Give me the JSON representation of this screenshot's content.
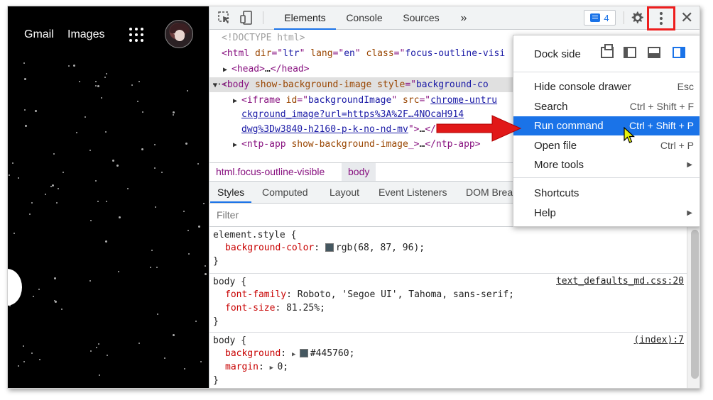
{
  "ntp": {
    "links": [
      "Gmail",
      "Images"
    ]
  },
  "devtools": {
    "tabs": [
      "Elements",
      "Console",
      "Sources"
    ],
    "more_tabs": "»",
    "badge_count": "4",
    "close": "✕",
    "dom_lines": [
      {
        "indent": 0,
        "parts": [
          [
            "gray",
            "<!DOCTYPE html>"
          ]
        ]
      },
      {
        "indent": 0,
        "parts": [
          [
            "tag",
            "<html "
          ],
          [
            "attr",
            "dir"
          ],
          [
            "tag",
            "=\""
          ],
          [
            "val",
            "ltr"
          ],
          [
            "tag",
            "\" "
          ],
          [
            "attr",
            "lang"
          ],
          [
            "tag",
            "=\""
          ],
          [
            "val",
            "en"
          ],
          [
            "tag",
            "\" "
          ],
          [
            "attr",
            "class"
          ],
          [
            "tag",
            "=\""
          ],
          [
            "val",
            "focus-outline-visi"
          ]
        ]
      },
      {
        "indent": 1,
        "tri": "▶",
        "parts": [
          [
            "tag",
            "<head>"
          ],
          [
            "plain",
            "…"
          ],
          [
            "tag",
            "</head>"
          ]
        ]
      },
      {
        "indent": 0,
        "tri": "▼",
        "prefix": "···",
        "sel": true,
        "parts": [
          [
            "tag",
            "<body "
          ],
          [
            "attr",
            "show-background-image"
          ],
          [
            "tag",
            " "
          ],
          [
            "attr",
            "style"
          ],
          [
            "tag",
            "=\""
          ],
          [
            "val",
            "background-co"
          ]
        ]
      },
      {
        "indent": 2,
        "tri": "▶",
        "parts": [
          [
            "tag",
            "<iframe "
          ],
          [
            "attr",
            "id"
          ],
          [
            "tag",
            "=\""
          ],
          [
            "val",
            "backgroundImage"
          ],
          [
            "tag",
            "\" "
          ],
          [
            "attr",
            "src"
          ],
          [
            "tag",
            "=\""
          ],
          [
            "link",
            "chrome-untru"
          ]
        ]
      },
      {
        "indent": 2,
        "parts": [
          [
            "link",
            "ckground_image?url=https%3A%2F…4NOcaH914"
          ]
        ]
      },
      {
        "indent": 2,
        "parts": [
          [
            "link",
            "dwg%3Dw3840-h2160-p-k-no-nd-mv"
          ],
          [
            "tag",
            "\">"
          ],
          [
            "plain",
            "…"
          ],
          [
            "tag",
            "</iframe"
          ]
        ]
      },
      {
        "indent": 2,
        "tri": "▶",
        "parts": [
          [
            "tag",
            "<ntp-app "
          ],
          [
            "attr",
            "show-background-image"
          ],
          [
            "tag",
            "_>"
          ],
          [
            "plain",
            "…"
          ],
          [
            "tag",
            "</ntp-app>"
          ]
        ]
      }
    ],
    "breadcrumbs": [
      "html.focus-outline-visible",
      "body"
    ],
    "subtabs": [
      "Styles",
      "Computed",
      "Layout",
      "Event Listeners",
      "DOM Brea"
    ],
    "filter_placeholder": "Filter",
    "rules": [
      {
        "selector": "element.style {",
        "source": "",
        "props": [
          {
            "name": "background-color",
            "value": "rgb(68, 87, 96);",
            "swatch": "#445760"
          }
        ]
      },
      {
        "selector": "body {",
        "source": "text_defaults_md.css:20",
        "props": [
          {
            "name": "font-family",
            "value": "Roboto, 'Segoe UI', Tahoma, sans-serif;"
          },
          {
            "name": "font-size",
            "value": "81.25%;"
          }
        ]
      },
      {
        "selector": "body {",
        "source": "(index):7",
        "props": [
          {
            "name": "background",
            "value": "#445760;",
            "swatch": "#445760",
            "tri": true
          },
          {
            "name": "margin",
            "value": "0;",
            "tri": true
          }
        ]
      }
    ]
  },
  "menu": {
    "dock_side": "Dock side",
    "items": [
      {
        "label": "Hide console drawer",
        "shortcut": "Esc"
      },
      {
        "label": "Search",
        "shortcut": "Ctrl + Shift + F"
      },
      {
        "label": "Run command",
        "shortcut": "Ctrl + Shift + P",
        "highlight": true
      },
      {
        "label": "Open file",
        "shortcut": "Ctrl + P"
      },
      {
        "label": "More tools",
        "submenu": true
      },
      {
        "label": "Shortcuts"
      },
      {
        "label": "Help",
        "submenu": true
      }
    ]
  },
  "colors": {
    "accent": "#1a73e8",
    "highlight_box": "#ee1d1d",
    "arrow": "#e11818",
    "swatch": "#445760"
  }
}
